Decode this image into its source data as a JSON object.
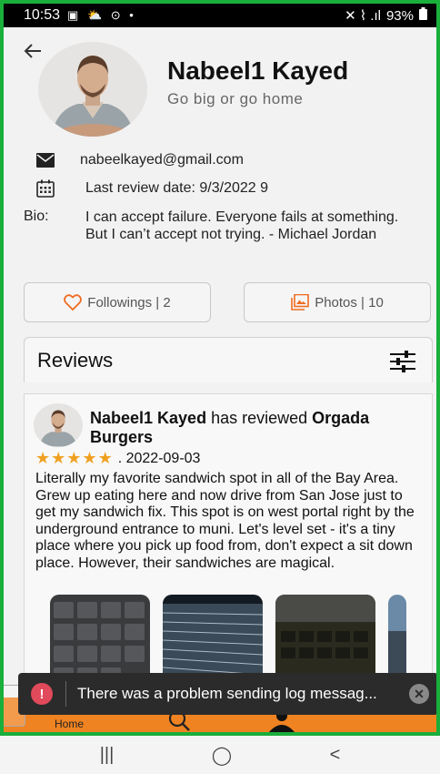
{
  "status_bar": {
    "time": "10:53",
    "left_icons": "▣ ⛅ ⊙ •",
    "right_icons": "✕ ⌇ .ıl",
    "battery": "93%"
  },
  "profile": {
    "name": "Nabeel1 Kayed",
    "tagline": "Go big or go home",
    "email": "nabeelkayed@gmail.com",
    "last_review": "Last review date: 9/3/2022 9",
    "bio_label": "Bio:",
    "bio": "I can accept failure. Everyone fails at something. But I can’t accept not trying. - Michael Jordan"
  },
  "buttons": {
    "followings": "Followings | 2",
    "photos": "Photos | 10"
  },
  "reviews": {
    "title": "Reviews"
  },
  "review": {
    "reviewer": "Nabeel1 Kayed",
    "connector": " has reviewed ",
    "place": "Orgada Burgers",
    "rating": 5,
    "date": ". 2022-09-03",
    "text": "Literally my favorite sandwich spot in all of the Bay Area. Grew up eating here and now drive from San Jose just to get my sandwich fix. This spot is on west portal right by the underground entrance to muni. Let's level set - it's a tiny place where you pick up food from, don't expect a sit down place. However, their sandwiches are magical."
  },
  "bottom_nav": {
    "home_label": "Home"
  },
  "toast": {
    "message": "There was a problem sending log messag..."
  },
  "system_nav": {
    "recents": "|||",
    "home": "◯",
    "back": "<"
  },
  "colors": {
    "accent": "#ef8321",
    "frame_border": "#1aae3b",
    "star": "#f0a020",
    "error": "#e04a5a"
  }
}
